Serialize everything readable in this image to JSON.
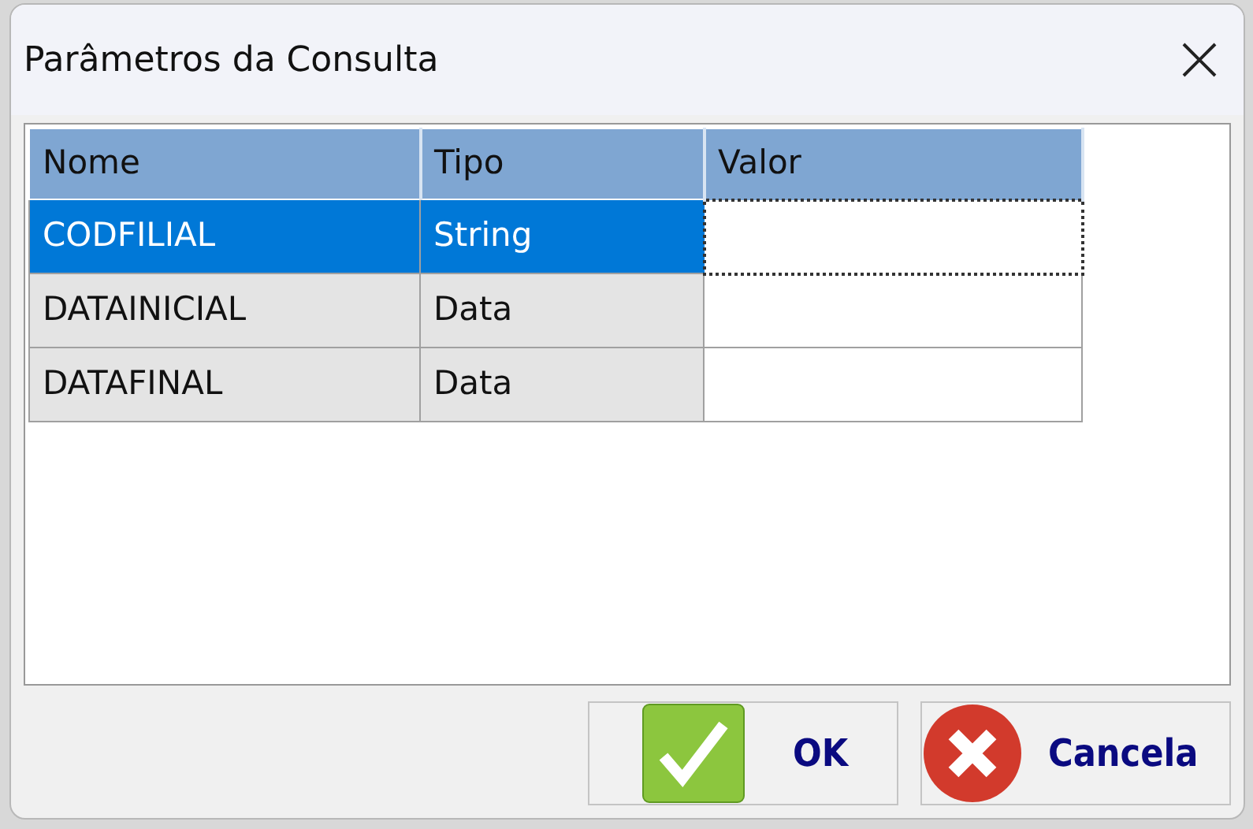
{
  "window": {
    "title": "Parâmetros da Consulta"
  },
  "table": {
    "columns": [
      "Nome",
      "Tipo",
      "Valor"
    ],
    "rows": [
      {
        "nome": "CODFILIAL",
        "tipo": "String",
        "valor": "",
        "selected": true
      },
      {
        "nome": "DATAINICIAL",
        "tipo": "Data",
        "valor": "",
        "selected": false
      },
      {
        "nome": "DATAFINAL",
        "tipo": "Data",
        "valor": "",
        "selected": false
      }
    ]
  },
  "buttons": [
    {
      "kind": "ok",
      "label": "OK"
    },
    {
      "kind": "cancel",
      "label": "Cancela"
    }
  ]
}
